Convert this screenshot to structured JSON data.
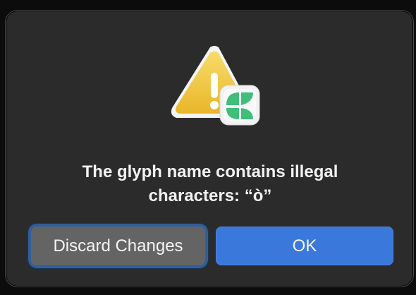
{
  "dialog": {
    "icon": "warning-triangle-with-glyphs-app-badge",
    "message_line1": "The glyph name contains illegal",
    "message_line2": "characters: “ò”",
    "discard_label": "Discard Changes",
    "ok_label": "OK"
  },
  "colors": {
    "dialog_bg": "#2b2b2c",
    "ok_button": "#3a78dc",
    "discard_button": "#646465",
    "focus_ring": "#2f5f9a",
    "warning_yellow": "#f0c642",
    "app_green": "#3fbf7a"
  }
}
